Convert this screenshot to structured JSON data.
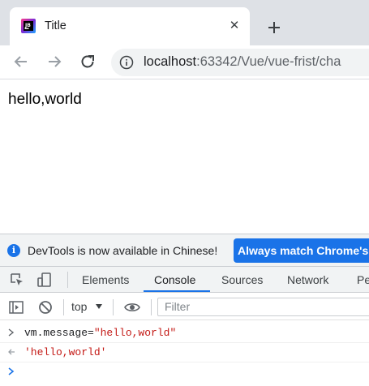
{
  "tab": {
    "title": "Title",
    "close": "✕"
  },
  "address": {
    "host": "localhost",
    "path": ":63342/Vue/vue-frist/cha"
  },
  "page": {
    "message": "hello,world"
  },
  "devtools": {
    "infobar": {
      "text": "DevTools is now available in Chinese!",
      "button": "Always match Chrome's"
    },
    "tabs": [
      "Elements",
      "Console",
      "Sources",
      "Network",
      "Pe"
    ],
    "active_tab": "Console",
    "console_bar": {
      "context": "top",
      "filter_placeholder": "Filter"
    },
    "console": {
      "input_prefix": "vm.message=",
      "input_value": "\"hello,world\"",
      "output": "'hello,world'"
    }
  },
  "colors": {
    "accent": "#1a73e8",
    "string": "#c41a16",
    "tabstrip": "#dee1e6"
  }
}
